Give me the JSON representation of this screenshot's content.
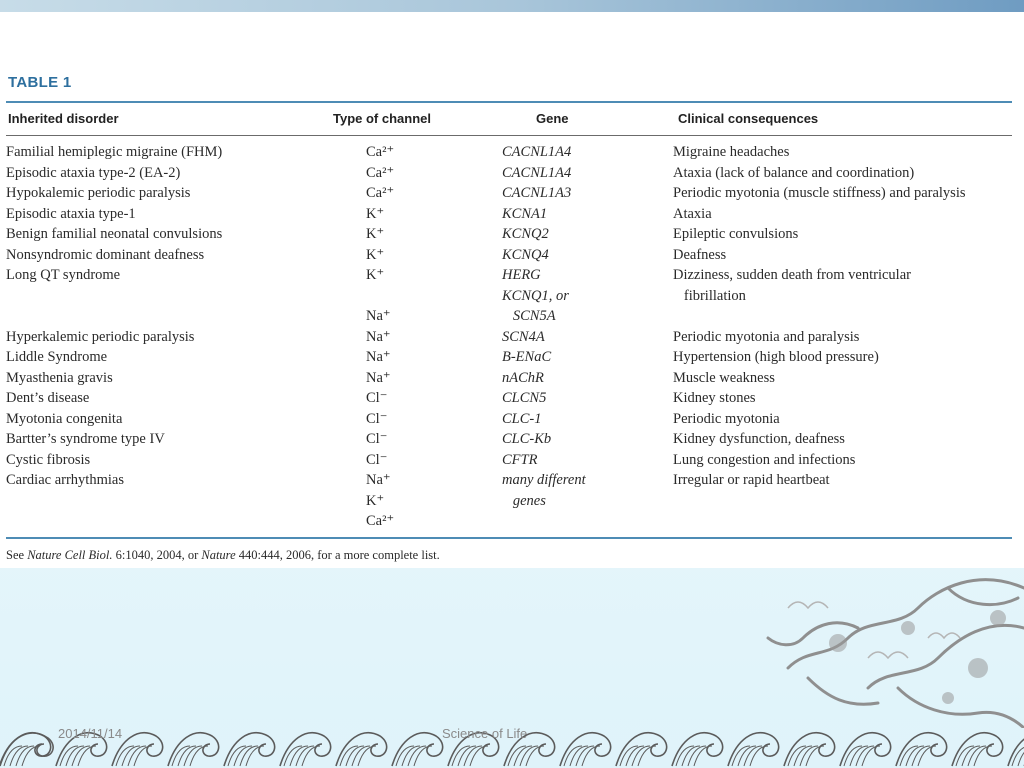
{
  "table": {
    "title": "TABLE 1",
    "headers": [
      "Inherited disorder",
      "Type of channel",
      "Gene",
      "Clinical consequences"
    ],
    "rows": [
      {
        "disorder": "Familial hemiplegic migraine (FHM)",
        "channel": "Ca²⁺",
        "gene": "CACNL1A4",
        "consequence": "Migraine headaches"
      },
      {
        "disorder": "Episodic ataxia type-2 (EA-2)",
        "channel": "Ca²⁺",
        "gene": "CACNL1A4",
        "consequence": "Ataxia (lack of balance and coordination)"
      },
      {
        "disorder": "Hypokalemic periodic paralysis",
        "channel": "Ca²⁺",
        "gene": "CACNL1A3",
        "consequence": "Periodic myotonia (muscle stiffness) and paralysis"
      },
      {
        "disorder": "Episodic ataxia type-1",
        "channel": "K⁺",
        "gene": "KCNA1",
        "consequence": "Ataxia"
      },
      {
        "disorder": "Benign familial neonatal convulsions",
        "channel": "K⁺",
        "gene": "KCNQ2",
        "consequence": "Epileptic convulsions"
      },
      {
        "disorder": "Nonsyndromic dominant deafness",
        "channel": "K⁺",
        "gene": "KCNQ4",
        "consequence": "Deafness"
      },
      {
        "disorder": "Long QT syndrome",
        "channel": "K⁺",
        "gene": "HERG",
        "consequence": "Dizziness, sudden death from ventricular"
      },
      {
        "disorder": "",
        "channel": "",
        "gene": "KCNQ1, or",
        "consequence": "   fibrillation"
      },
      {
        "disorder": "",
        "channel": "Na⁺",
        "gene": "   SCN5A",
        "consequence": ""
      },
      {
        "disorder": "Hyperkalemic periodic paralysis",
        "channel": "Na⁺",
        "gene": "SCN4A",
        "consequence": "Periodic myotonia and paralysis"
      },
      {
        "disorder": "Liddle Syndrome",
        "channel": "Na⁺",
        "gene": "B-ENaC",
        "consequence": "Hypertension (high blood pressure)"
      },
      {
        "disorder": "Myasthenia gravis",
        "channel": "Na⁺",
        "gene": "nAChR",
        "consequence": "Muscle weakness"
      },
      {
        "disorder": "Dent’s disease",
        "channel": "Cl⁻",
        "gene": "CLCN5",
        "consequence": "Kidney stones"
      },
      {
        "disorder": "Myotonia congenita",
        "channel": "Cl⁻",
        "gene": "CLC-1",
        "consequence": "Periodic myotonia"
      },
      {
        "disorder": "Bartter’s syndrome type IV",
        "channel": "Cl⁻",
        "gene": "CLC-Kb",
        "consequence": "Kidney dysfunction, deafness"
      },
      {
        "disorder": "Cystic fibrosis",
        "channel": "Cl⁻",
        "gene": "CFTR",
        "consequence": "Lung congestion and infections"
      },
      {
        "disorder": "Cardiac arrhythmias",
        "channel": "Na⁺",
        "gene": "many different",
        "consequence": "Irregular or rapid heartbeat"
      },
      {
        "disorder": "",
        "channel": "K⁺",
        "gene": "   genes",
        "consequence": ""
      },
      {
        "disorder": "",
        "channel": "Ca²⁺",
        "gene": "",
        "consequence": ""
      }
    ]
  },
  "footnote": {
    "pre": "See ",
    "journal1": "Nature Cell Biol.",
    "mid": " 6:1040, 2004, or ",
    "journal2": "Nature",
    "post": " 440:444, 2006, for a more complete list."
  },
  "footer": {
    "date": "2014/11/14",
    "center": "Science of Life"
  },
  "colors": {
    "title": "#2d6f9e",
    "rule": "#4e8cb5",
    "background": "#e6f6fb"
  },
  "icons": [
    "dragon-decoration",
    "wave-border"
  ]
}
